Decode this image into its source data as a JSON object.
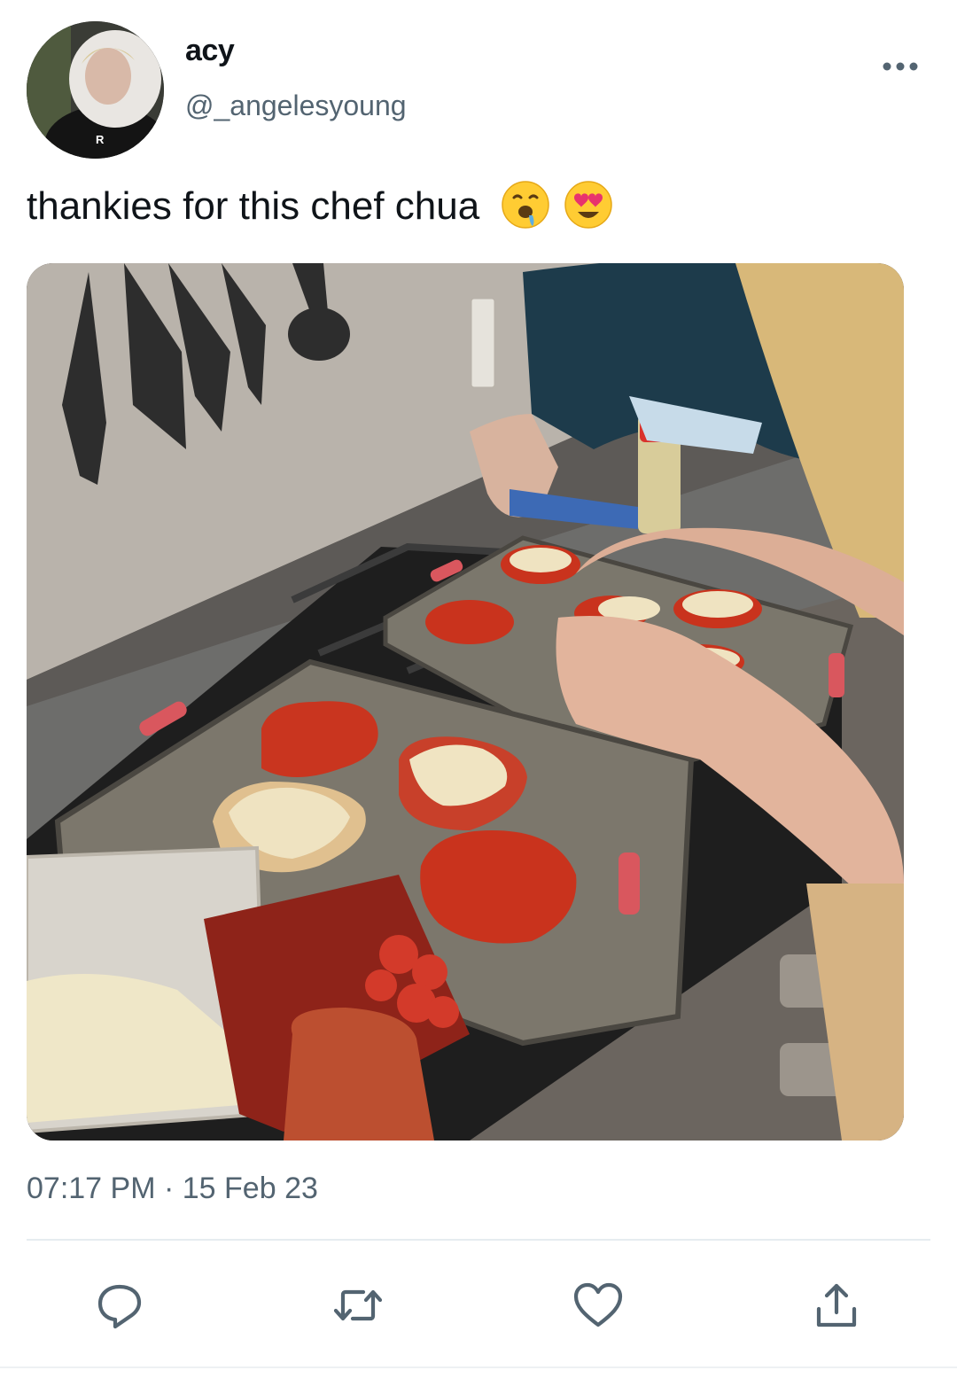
{
  "tweet": {
    "display_name": "acy",
    "handle": "@_angelesyoung",
    "text": "thankies for this chef chua",
    "emojis": [
      "drooling-face-emoji",
      "heart-eyes-emoji"
    ],
    "time": "07:17 PM",
    "separator": "·",
    "date": "15 Feb 23"
  },
  "actions": [
    {
      "name": "reply",
      "icon": "reply-icon"
    },
    {
      "name": "retweet",
      "icon": "retweet-icon"
    },
    {
      "name": "like",
      "icon": "heart-icon"
    },
    {
      "name": "share",
      "icon": "share-icon"
    }
  ],
  "colors": {
    "secondary_text": "#536471",
    "icon": "#536471",
    "divider": "#e6ecf0"
  }
}
